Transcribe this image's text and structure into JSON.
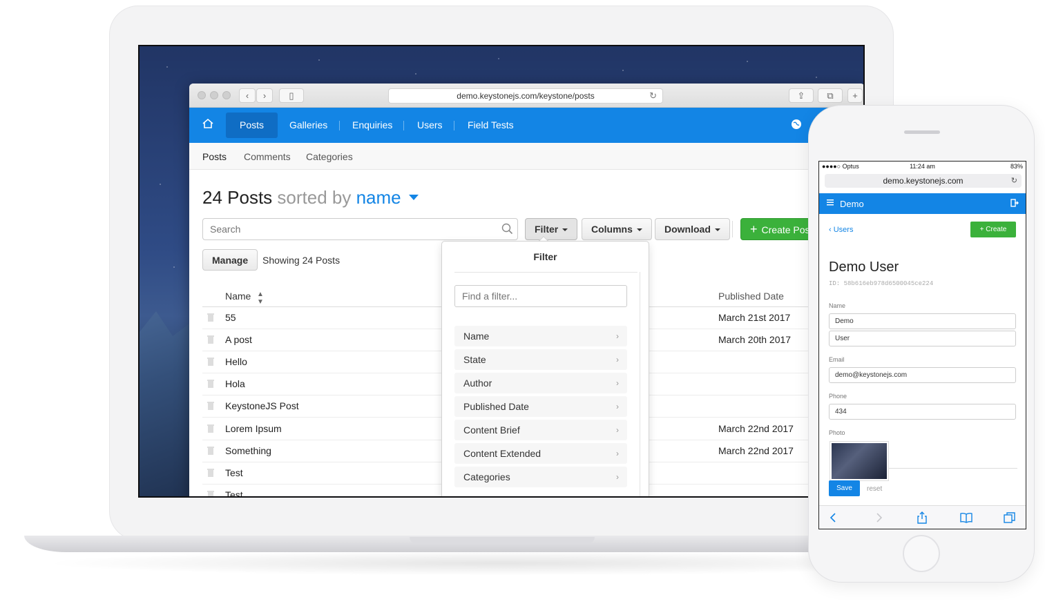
{
  "browser": {
    "url": "demo.keystonejs.com/keystone/posts"
  },
  "nav": {
    "items": [
      "Posts",
      "Galleries",
      "Enquiries",
      "Users",
      "Field Tests"
    ],
    "active": "Posts",
    "accent": "#1385e5"
  },
  "subnav": {
    "items": [
      "Posts",
      "Comments",
      "Categories"
    ]
  },
  "list": {
    "title_count": "24 Posts",
    "title_sorted": "sorted by",
    "title_sort_field": "name",
    "search_placeholder": "Search",
    "filter_label": "Filter",
    "columns_label": "Columns",
    "download_label": "Download",
    "create_label": "Create Post",
    "create_color": "#3bb13b",
    "manage_label": "Manage",
    "showing": "Showing 24 Posts",
    "col_name": "Name",
    "col_date": "Published Date",
    "rows": [
      {
        "name": "55",
        "date": "March 21st 2017"
      },
      {
        "name": "A post",
        "date": "March 20th 2017"
      },
      {
        "name": "Hello",
        "date": ""
      },
      {
        "name": "Hola",
        "date": ""
      },
      {
        "name": "KeystoneJS Post",
        "date": ""
      },
      {
        "name": "Lorem Ipsum",
        "date": "March 22nd 2017"
      },
      {
        "name": "Something",
        "date": "March 22nd 2017"
      },
      {
        "name": "Test",
        "date": ""
      },
      {
        "name": "Test",
        "date": ""
      }
    ]
  },
  "filter_popover": {
    "title": "Filter",
    "search_placeholder": "Find a filter...",
    "items": [
      "Name",
      "State",
      "Author",
      "Published Date",
      "Content Brief",
      "Content Extended",
      "Categories"
    ]
  },
  "mobile": {
    "carrier": "●●●●○ Optus",
    "time": "11:24 am",
    "battery": "83%",
    "url": "demo.keystonejs.com",
    "brand": "Demo",
    "back_label": "Users",
    "create_label": "Create",
    "title": "Demo User",
    "id": "ID: 58b616eb978d6500045ce224",
    "name_label": "Name",
    "first_name": "Demo",
    "last_name": "User",
    "email_label": "Email",
    "email": "demo@keystonejs.com",
    "phone_label": "Phone",
    "phone": "434",
    "photo_label": "Photo",
    "save_label": "Save",
    "reset_label": "reset"
  }
}
